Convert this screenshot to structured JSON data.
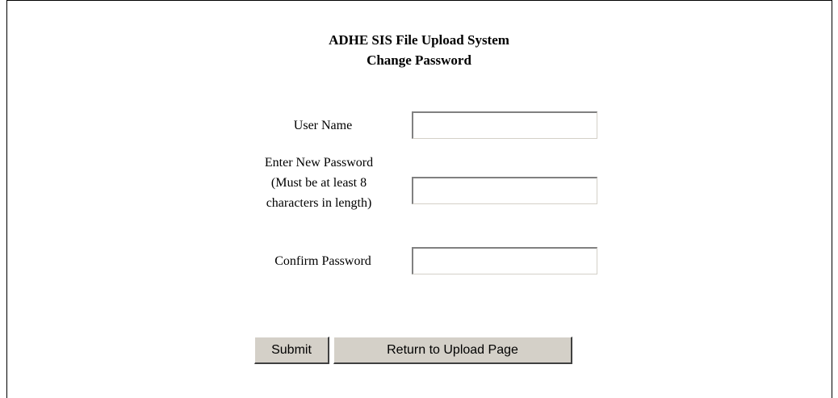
{
  "header": {
    "line1": "ADHE SIS File Upload System",
    "line2": "Change Password"
  },
  "form": {
    "user_name_label": "User Name",
    "user_name_value": "",
    "new_password_label_line1": "Enter New Password",
    "new_password_label_line2": "(Must be at least 8",
    "new_password_label_line3": "characters in length)",
    "new_password_value": "",
    "confirm_password_label": "Confirm Password",
    "confirm_password_value": ""
  },
  "buttons": {
    "submit_label": "Submit",
    "return_label": "Return to Upload Page"
  }
}
